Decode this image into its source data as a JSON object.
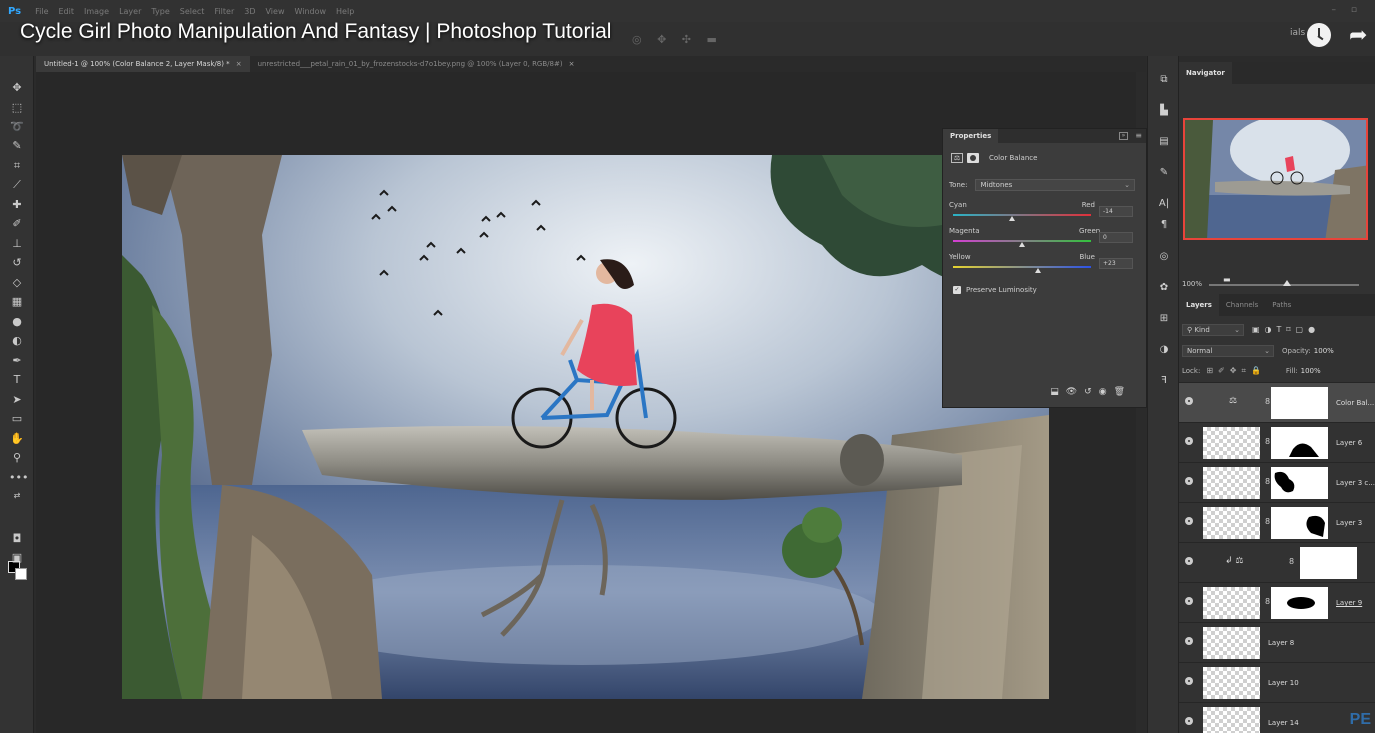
{
  "video": {
    "title": "Cycle Girl Photo Manipulation And Fantasy | Photoshop Tutorial"
  },
  "menubar": {
    "logo": "Ps",
    "items": [
      "File",
      "Edit",
      "Image",
      "Layer",
      "Type",
      "Select",
      "Filter",
      "3D",
      "View",
      "Window",
      "Help"
    ]
  },
  "optbar": {
    "right_label": "ials"
  },
  "tabs": [
    {
      "label": "Untitled-1 @ 100% (Color Balance 2, Layer Mask/8) *",
      "close": "×"
    },
    {
      "label": "unrestricted___petal_rain_01_by_frozenstocks-d7o1bey.png @ 100% (Layer 0, RGB/8#)",
      "close": "×"
    }
  ],
  "properties": {
    "title": "Properties",
    "adjustment_name": "Color Balance",
    "tone_label": "Tone:",
    "tone_value": "Midtones",
    "sliders": [
      {
        "left": "Cyan",
        "right": "Red",
        "value": "-14",
        "level": -14,
        "gradient": [
          "#2ab3c6",
          "#e0303a"
        ]
      },
      {
        "left": "Magenta",
        "right": "Green",
        "value": "0",
        "level": 0,
        "gradient": [
          "#d33fd1",
          "#33c23d"
        ]
      },
      {
        "left": "Yellow",
        "right": "Blue",
        "value": "+23",
        "level": 23,
        "gradient": [
          "#e6d330",
          "#2c52e6"
        ]
      }
    ],
    "preserve_luminosity": {
      "label": "Preserve Luminosity",
      "checked": true
    }
  },
  "navigator": {
    "tab": "Navigator",
    "zoom": "100%"
  },
  "layers": {
    "tabs": [
      "Layers",
      "Channels",
      "Paths"
    ],
    "kind": "Kind",
    "blend": "Normal",
    "opacity_label": "Opacity:",
    "opacity_value": "100%",
    "lock_label": "Lock:",
    "fill_label": "Fill:",
    "fill_value": "100%",
    "rows": [
      {
        "name": "Color Bal...",
        "selected": true
      },
      {
        "name": "Layer 6"
      },
      {
        "name": "Layer 3 c..."
      },
      {
        "name": "Layer 3"
      },
      {
        "name": ""
      },
      {
        "name": "Layer 9"
      },
      {
        "name": "Layer 8"
      },
      {
        "name": "Layer 10"
      },
      {
        "name": "Layer 14"
      }
    ]
  },
  "watermark": "PE",
  "colors": {
    "accent": "#31a8ff",
    "nav_border": "#e8443a"
  }
}
